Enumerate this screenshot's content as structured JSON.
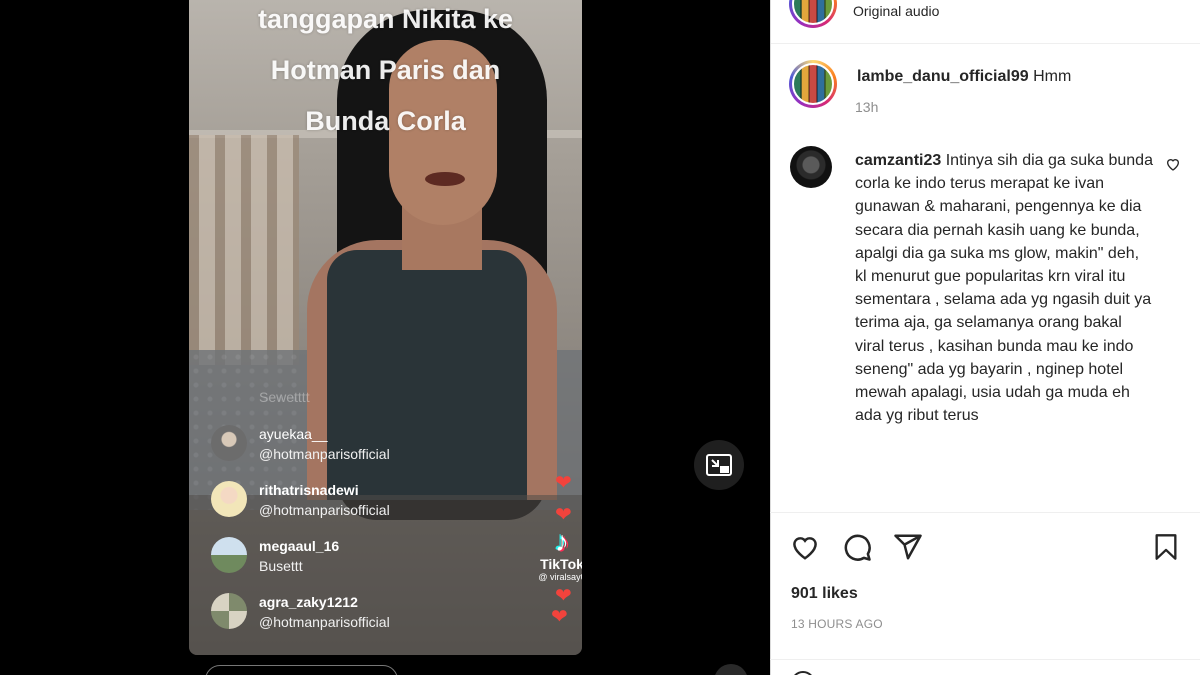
{
  "video": {
    "caption_lines": [
      "tanggapan Nikita ke",
      "Hotman Paris dan",
      "Bunda Corla"
    ],
    "faded_comment": "Sewetttt",
    "live_comments": [
      {
        "user": "ayuekaa__",
        "text": "@hotmanparisofficial"
      },
      {
        "user": "rithatrisnadewi",
        "text": "@hotmanparisofficial"
      },
      {
        "user": "megaaul_16",
        "text": "Busettt"
      },
      {
        "user": "agra_zaky1212",
        "text": "@hotmanparisofficial"
      }
    ],
    "watermark": {
      "name": "TikTok",
      "handle": "@ viralsay0"
    }
  },
  "panel": {
    "audio_label": "Original audio",
    "post": {
      "username": "lambe_danu_official99",
      "caption": "Hmm",
      "time": "13h"
    },
    "comment": {
      "username": "camzanti23",
      "text": "Intinya sih dia ga suka bunda corla ke indo terus merapat ke ivan gunawan & maharani, pengennya ke dia secara dia pernah kasih uang ke bunda, apalgi dia ga suka ms glow, makin\" deh, kl menurut gue popularitas krn viral itu sementara , selama ada yg ngasih duit ya terima aja, ga selamanya orang bakal viral terus , kasihan bunda mau ke indo seneng\" ada yg bayarin , nginep hotel mewah apalagi, usia udah ga muda eh ada yg ribut terus"
    },
    "likes": "901 likes",
    "post_time": "13 HOURS AGO"
  },
  "icons": [
    "heart-icon",
    "comment-icon",
    "share-icon",
    "bookmark-icon",
    "picture-in-picture-icon",
    "tiktok-logo-icon"
  ],
  "colors": {
    "like_red": "#f2433c",
    "text": "#262626",
    "muted": "#8e8e8e"
  }
}
